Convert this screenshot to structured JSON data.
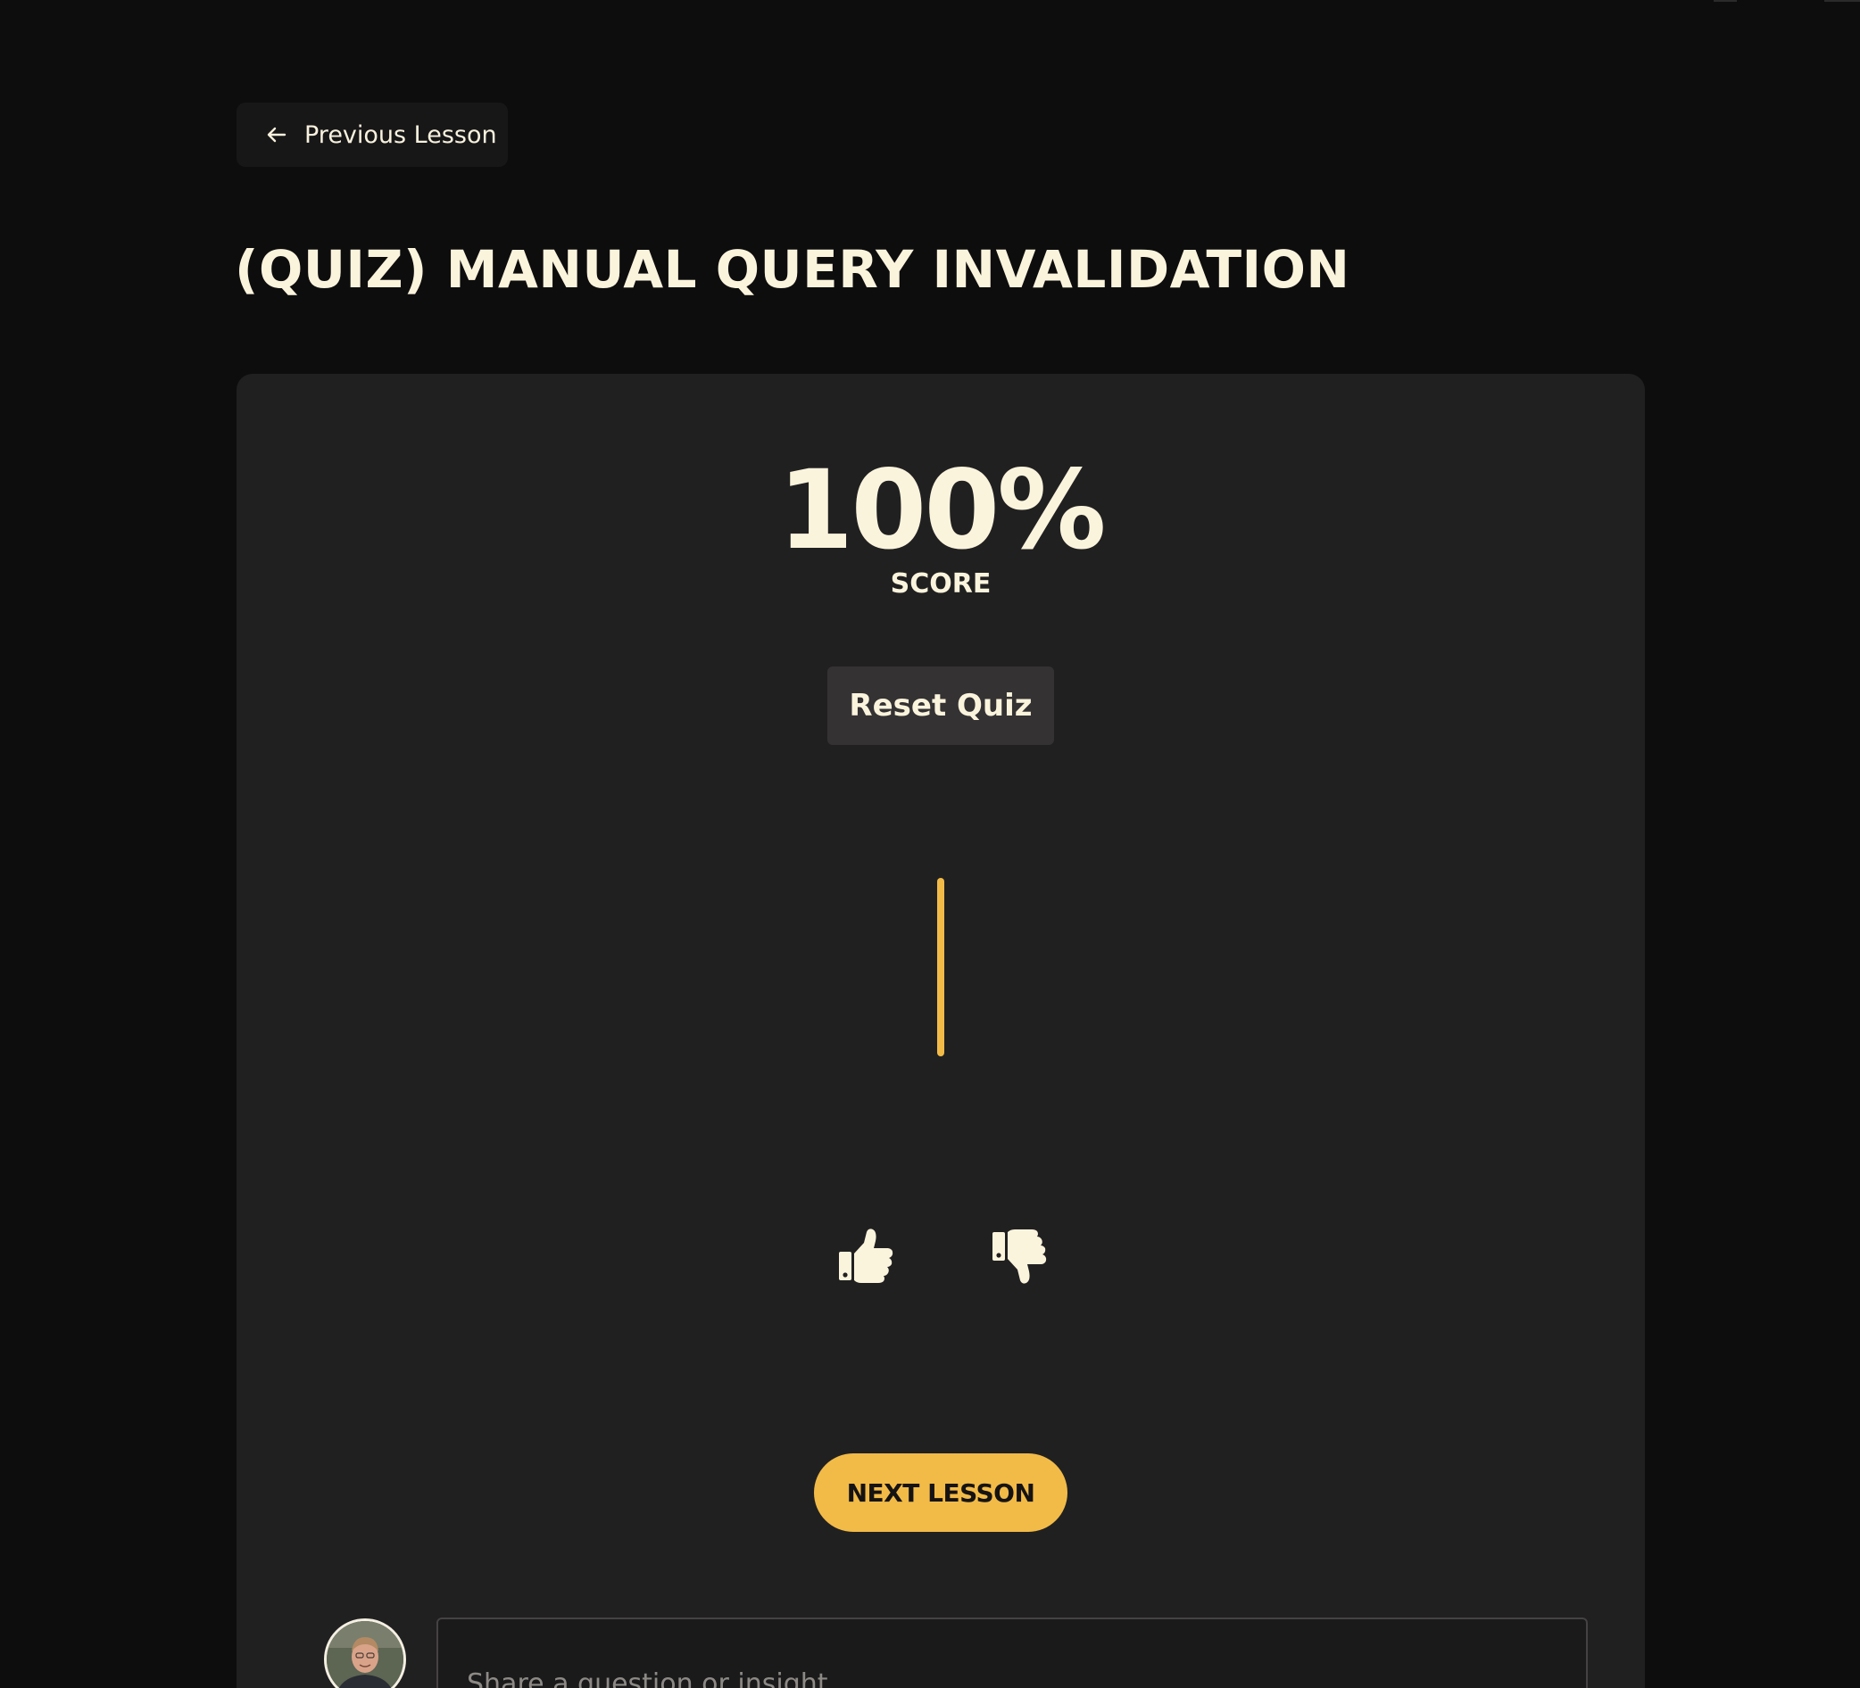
{
  "nav": {
    "previous_lesson_label": "Previous Lesson"
  },
  "lesson": {
    "title": "(QUIZ) MANUAL QUERY INVALIDATION"
  },
  "quiz": {
    "score_value": "100%",
    "score_label": "SCORE",
    "reset_label": "Reset Quiz"
  },
  "feedback": {
    "thumbs_up_icon": "thumbs-up-icon",
    "thumbs_down_icon": "thumbs-down-icon"
  },
  "next_lesson_label": "NEXT LESSON",
  "comment": {
    "placeholder": "Share a question or insight."
  },
  "colors": {
    "background": "#0e0d0e",
    "card": "#212021",
    "text": "#fbf4dd",
    "accent": "#f2bb48"
  }
}
